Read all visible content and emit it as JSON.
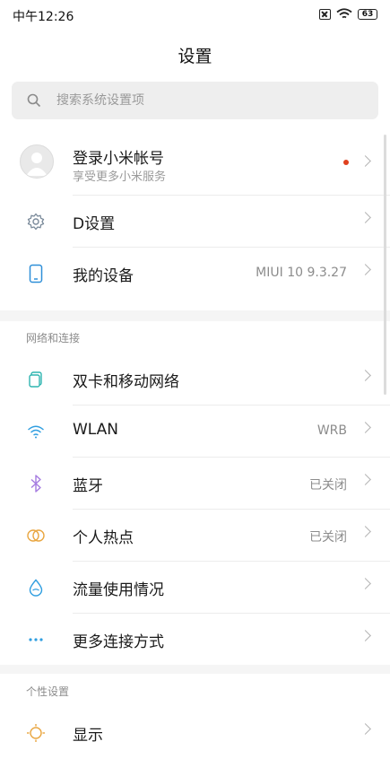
{
  "status_bar": {
    "time": "中午12:26",
    "battery": "63"
  },
  "header": {
    "title": "设置"
  },
  "search": {
    "placeholder": "搜索系统设置项"
  },
  "account": {
    "title": "登录小米帐号",
    "subtitle": "享受更多小米服务"
  },
  "top_items": [
    {
      "label": "D设置",
      "value": "",
      "icon": "gear-icon"
    },
    {
      "label": "我的设备",
      "value": "MIUI 10 9.3.27",
      "icon": "phone-icon"
    }
  ],
  "sections": [
    {
      "title": "网络和连接",
      "items": [
        {
          "label": "双卡和移动网络",
          "value": "",
          "icon": "sim-cards-icon"
        },
        {
          "label": "WLAN",
          "value": "WRB",
          "icon": "wifi-icon"
        },
        {
          "label": "蓝牙",
          "value": "已关闭",
          "icon": "bluetooth-icon"
        },
        {
          "label": "个人热点",
          "value": "已关闭",
          "icon": "hotspot-icon"
        },
        {
          "label": "流量使用情况",
          "value": "",
          "icon": "data-drop-icon"
        },
        {
          "label": "更多连接方式",
          "value": "",
          "icon": "more-dots-icon"
        }
      ]
    },
    {
      "title": "个性设置",
      "items": [
        {
          "label": "显示",
          "value": "",
          "icon": "display-sun-icon"
        }
      ]
    }
  ],
  "colors": {
    "accent_red_dot": "#e0401e",
    "section_bg": "#f5f5f5",
    "search_bg": "#eeeeee"
  }
}
